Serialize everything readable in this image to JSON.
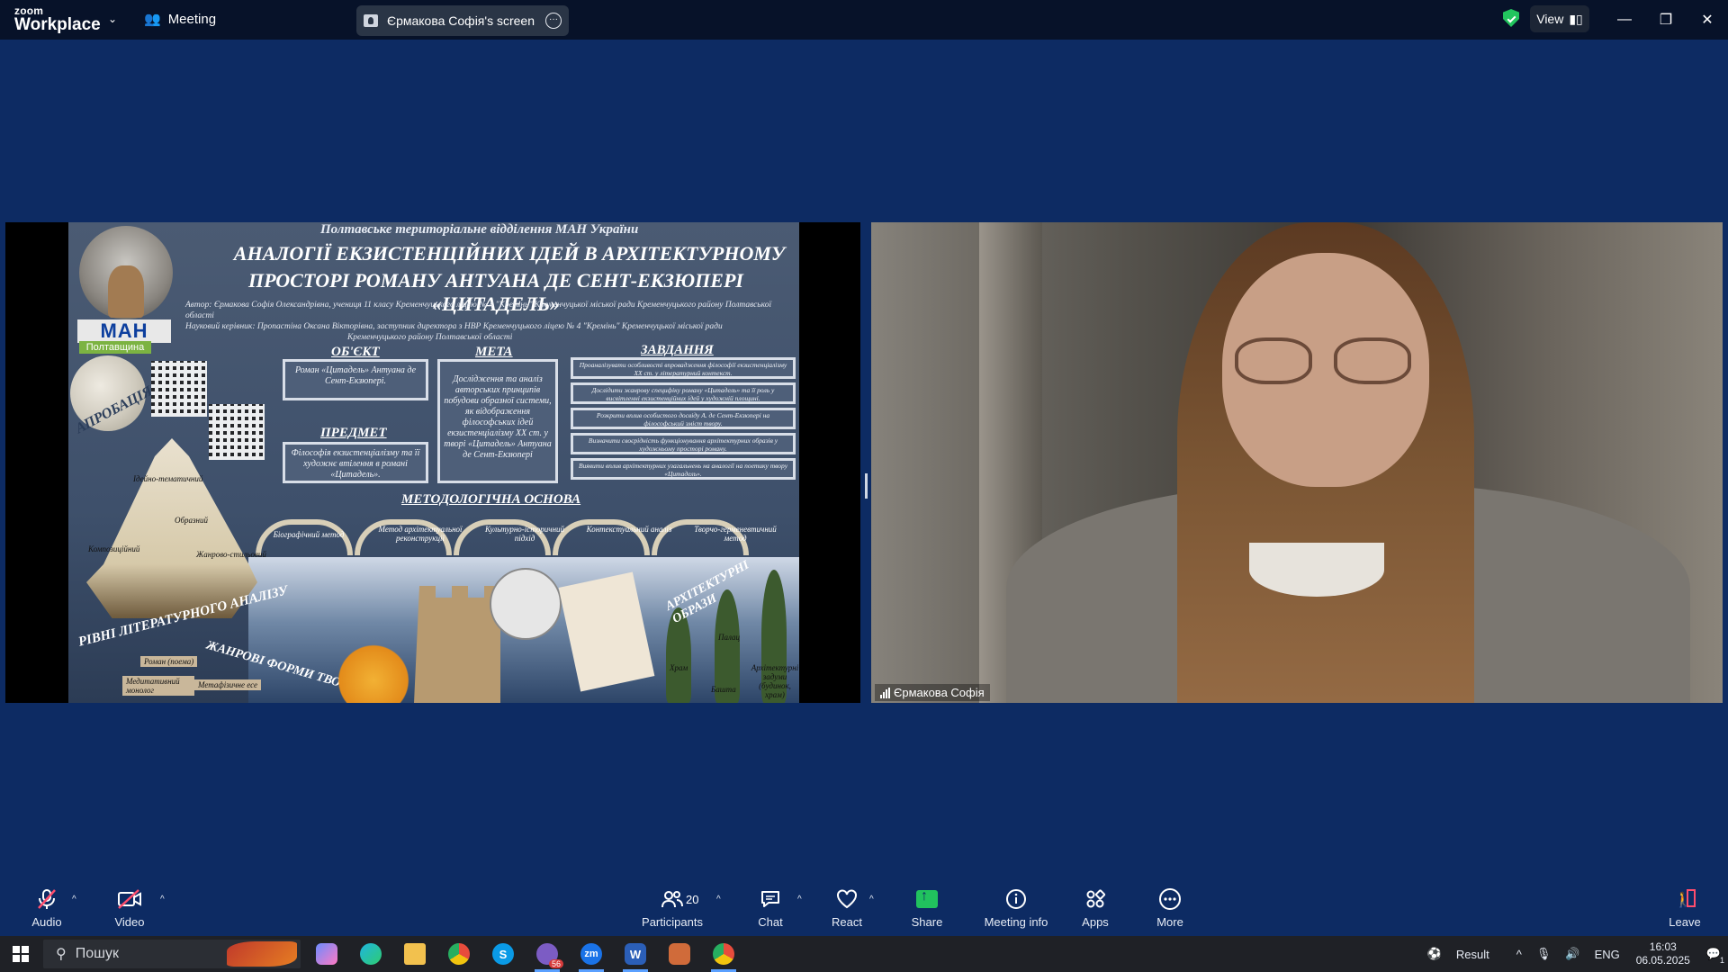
{
  "app": {
    "brand_top": "zoom",
    "brand_bottom": "Workplace",
    "meeting_label": "Meeting",
    "screen_tab_label": "Єрмакова Софія's screen",
    "view_label": "View"
  },
  "slide": {
    "org": "Полтавське територіальне відділення МАН України",
    "title_line1": "АНАЛОГІЇ ЕКЗИСТЕНЦІЙНИХ ІДЕЙ В АРХІТЕКТУРНОМУ",
    "title_line2": "ПРОСТОРІ РОМАНУ АНТУАНА ДЕ СЕНТ-ЕКЗЮПЕРІ «ЦИТАДЕЛЬ»",
    "author_line1": "Автор: Єрмакова Софія Олександрівна, учениця 11 класу Кременчуцького ліцею № 4 \"Кремінь\" Кременчуцької міської ради Кременчуцького району Полтавської області",
    "author_line2": "Науковий керівник: Пропастіна Оксана Вікторівна, заступник директора з НВР Кременчуцького ліцею № 4 \"Кремінь\" Кременчуцької міської ради",
    "author_line3": "Кременчуцького району Полтавської області",
    "logo_text": "МАН",
    "region": "Полтавщина",
    "aprobation": "АПРОБАЦІЯ",
    "object_header": "ОБ'ЄКТ",
    "object_text": "Роман «Цитадель» Антуана де Сент-Екзюпері.",
    "subject_header": "ПРЕДМЕТ",
    "subject_text": "Філософія екзистенціалізму та її художнє втілення в романі «Цитадель».",
    "goal_header": "МЕТА",
    "goal_text": "Дослідження та аналіз авторських принципів побудови образної системи, як відображення філософських ідей екзистенціалізму XX ст. у творі «Цитадель» Антуана де Сент-Екзюпері",
    "tasks_header": "ЗАВДАННЯ",
    "tasks": [
      "Проаналізувати особливості впровадження філософії екзистенціалізму XX ст. у літературний контекст.",
      "Дослідити жанрову специфіку роману «Цитадель» та її роль у висвітленні екзистенційних ідей у художній площині.",
      "Розкрити вплив особистого досвіду А. де Сент-Екзюпері на філософський зміст твору.",
      "Визначити своєрідність функціонування архітектурних образів у художньому просторі роману.",
      "Виявити вплив архітектурних узагальнень на аналогії на поетику твору «Цитадель»."
    ],
    "methods_header": "МЕТОДОЛОГІЧНА ОСНОВА",
    "methods": [
      "Біографічний метод",
      "Метод архітектуальної реконструкції",
      "Культурно-історичний підхід",
      "Контекстуальний аналіз",
      "Творчо-герменевтичний метод"
    ],
    "ship_labels": [
      "Ідейно-тематичний",
      "Образний",
      "Композиційний",
      "Жанрово-стильовий"
    ],
    "levels_title": "РІВНІ ЛІТЕРАТУРНОГО АНАЛІЗУ",
    "genre_title": "ЖАНРОВІ ФОРМИ ТВОРУ",
    "genre_labels": [
      "Роман (поема)",
      "Медитативний монолог",
      "Метафізичне есе"
    ],
    "arch_title": "АРХІТЕКТУРНІ ОБРАЗИ",
    "arch_labels": [
      "Палац",
      "Храм",
      "Башта",
      "Архітектурні задуми (будинок, храм)"
    ]
  },
  "video": {
    "participant_name": "Єрмакова Софія"
  },
  "toolbar": {
    "audio": "Audio",
    "video": "Video",
    "participants": "Participants",
    "participants_count": "20",
    "chat": "Chat",
    "react": "React",
    "share": "Share",
    "meeting_info": "Meeting info",
    "apps": "Apps",
    "more": "More",
    "leave": "Leave"
  },
  "taskbar": {
    "search_placeholder": "Пошук",
    "zoom_app": "zm",
    "word_app": "W",
    "skype_app": "S",
    "viber_badge": "56",
    "result_label": "Result",
    "lang": "ENG",
    "time": "16:03",
    "date": "06.05.2025",
    "notif_count": "1"
  },
  "colors": {
    "meeting_bg": "#0d2b63",
    "titlebar_bg": "#071229",
    "share_green": "#21c25e",
    "leave_red": "#ff4d6d"
  }
}
